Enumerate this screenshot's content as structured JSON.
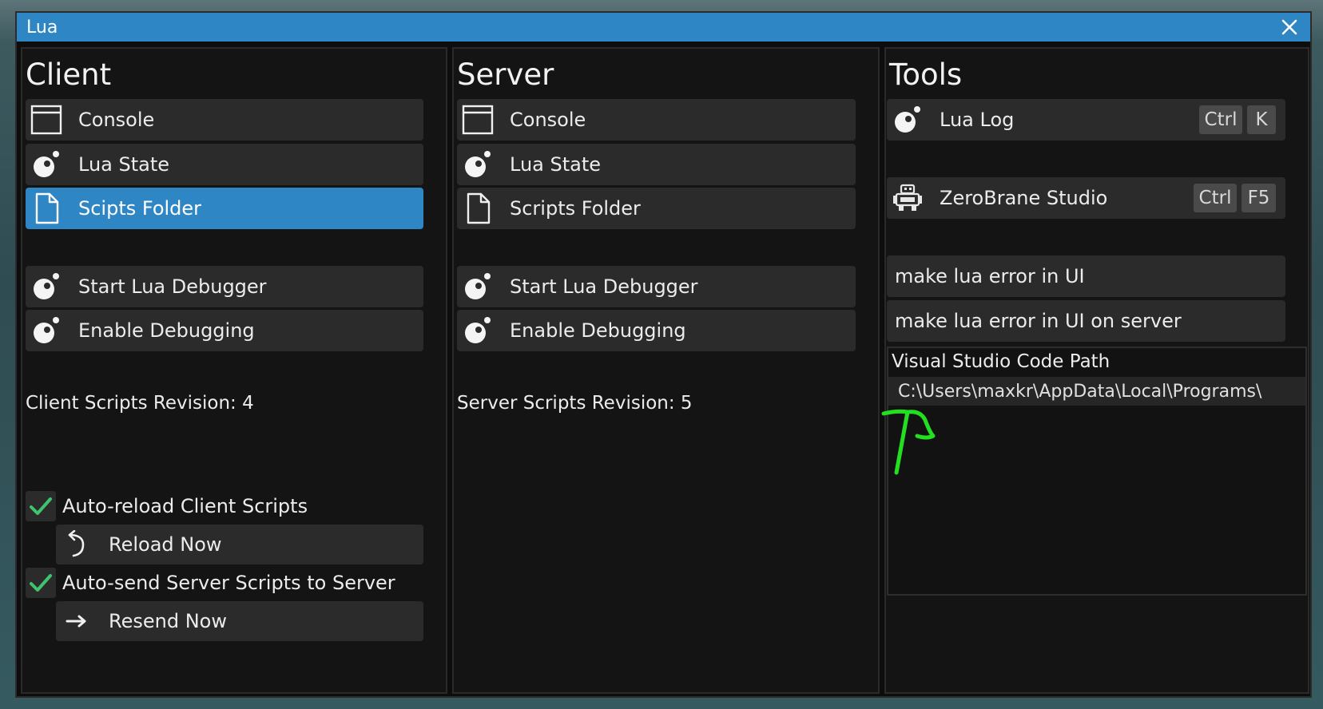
{
  "window": {
    "title": "Lua"
  },
  "icons": {
    "close": "close-icon",
    "console": "window-icon",
    "lua_state": "lua-logo-icon",
    "scripts_folder": "document-icon",
    "debugger": "lua-logo-icon",
    "reload": "undo-arrow-icon",
    "resend": "right-arrow-icon",
    "zerobrane": "robot-icon",
    "check": "checkmark-icon"
  },
  "colors": {
    "accent": "#2f86c4",
    "check": "#3ec46d",
    "annotation": "#22e01f"
  },
  "client": {
    "title": "Client",
    "console_label": "Console",
    "lua_state_label": "Lua State",
    "scripts_folder_label": "Scipts Folder",
    "start_debugger_label": "Start Lua Debugger",
    "enable_debugging_label": "Enable Debugging",
    "revision_text": "Client Scripts Revision: 4",
    "auto_reload_label": "Auto-reload Client Scripts",
    "auto_reload_checked": true,
    "reload_now_label": "Reload Now",
    "auto_send_label": "Auto-send Server Scripts to Server",
    "auto_send_checked": true,
    "resend_now_label": "Resend Now"
  },
  "server": {
    "title": "Server",
    "console_label": "Console",
    "lua_state_label": "Lua State",
    "scripts_folder_label": "Scripts Folder",
    "start_debugger_label": "Start Lua Debugger",
    "enable_debugging_label": "Enable Debugging",
    "revision_text": "Server Scripts Revision: 5"
  },
  "tools": {
    "title": "Tools",
    "lua_log_label": "Lua Log",
    "lua_log_keys": [
      "Ctrl",
      "K"
    ],
    "zerobrane_label": "ZeroBrane Studio",
    "zerobrane_keys": [
      "Ctrl",
      "F5"
    ],
    "make_error_ui_label": "make lua error in UI",
    "make_error_ui_server_label": "make lua error in UI on server",
    "vscode_path_label": "Visual Studio Code Path",
    "vscode_path_value": "C:\\Users\\maxkr\\AppData\\Local\\Programs\\"
  }
}
